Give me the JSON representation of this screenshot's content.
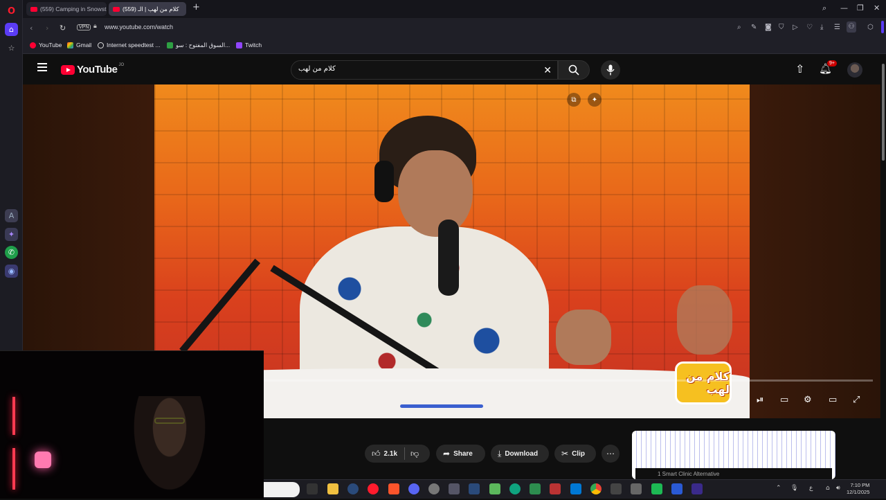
{
  "browser": {
    "tabs": [
      {
        "label": "(559) Camping in Snowst"
      },
      {
        "label": "(559) كلام من لهب | الـ"
      }
    ],
    "new_tab_label": "+",
    "url": "www.youtube.com/watch",
    "vpn_label": "VPN",
    "bookmarks": [
      {
        "label": "YouTube"
      },
      {
        "label": "Gmail"
      },
      {
        "label": "Internet speedtest ..."
      },
      {
        "label": "السوق المفتوح : سو..."
      },
      {
        "label": "Twitch"
      }
    ]
  },
  "youtube": {
    "logo_text": "YouTube",
    "logo_country": "JO",
    "search_value": "كلام من لهب",
    "notifications_badge": "9+",
    "video_logo_text": "كلام من لهب",
    "actions": {
      "likes": "2.1k",
      "share": "Share",
      "download": "Download",
      "clip": "Clip"
    },
    "ad_title": "1 Smart Clinic Alternative"
  },
  "taskbar": {
    "time": "7:10 PM",
    "date": "12/1/2025",
    "lang": "ع"
  },
  "colors": {
    "yt_red": "#ff0033",
    "opera_red": "#ff1b2d",
    "badge_red": "#cc0000"
  }
}
